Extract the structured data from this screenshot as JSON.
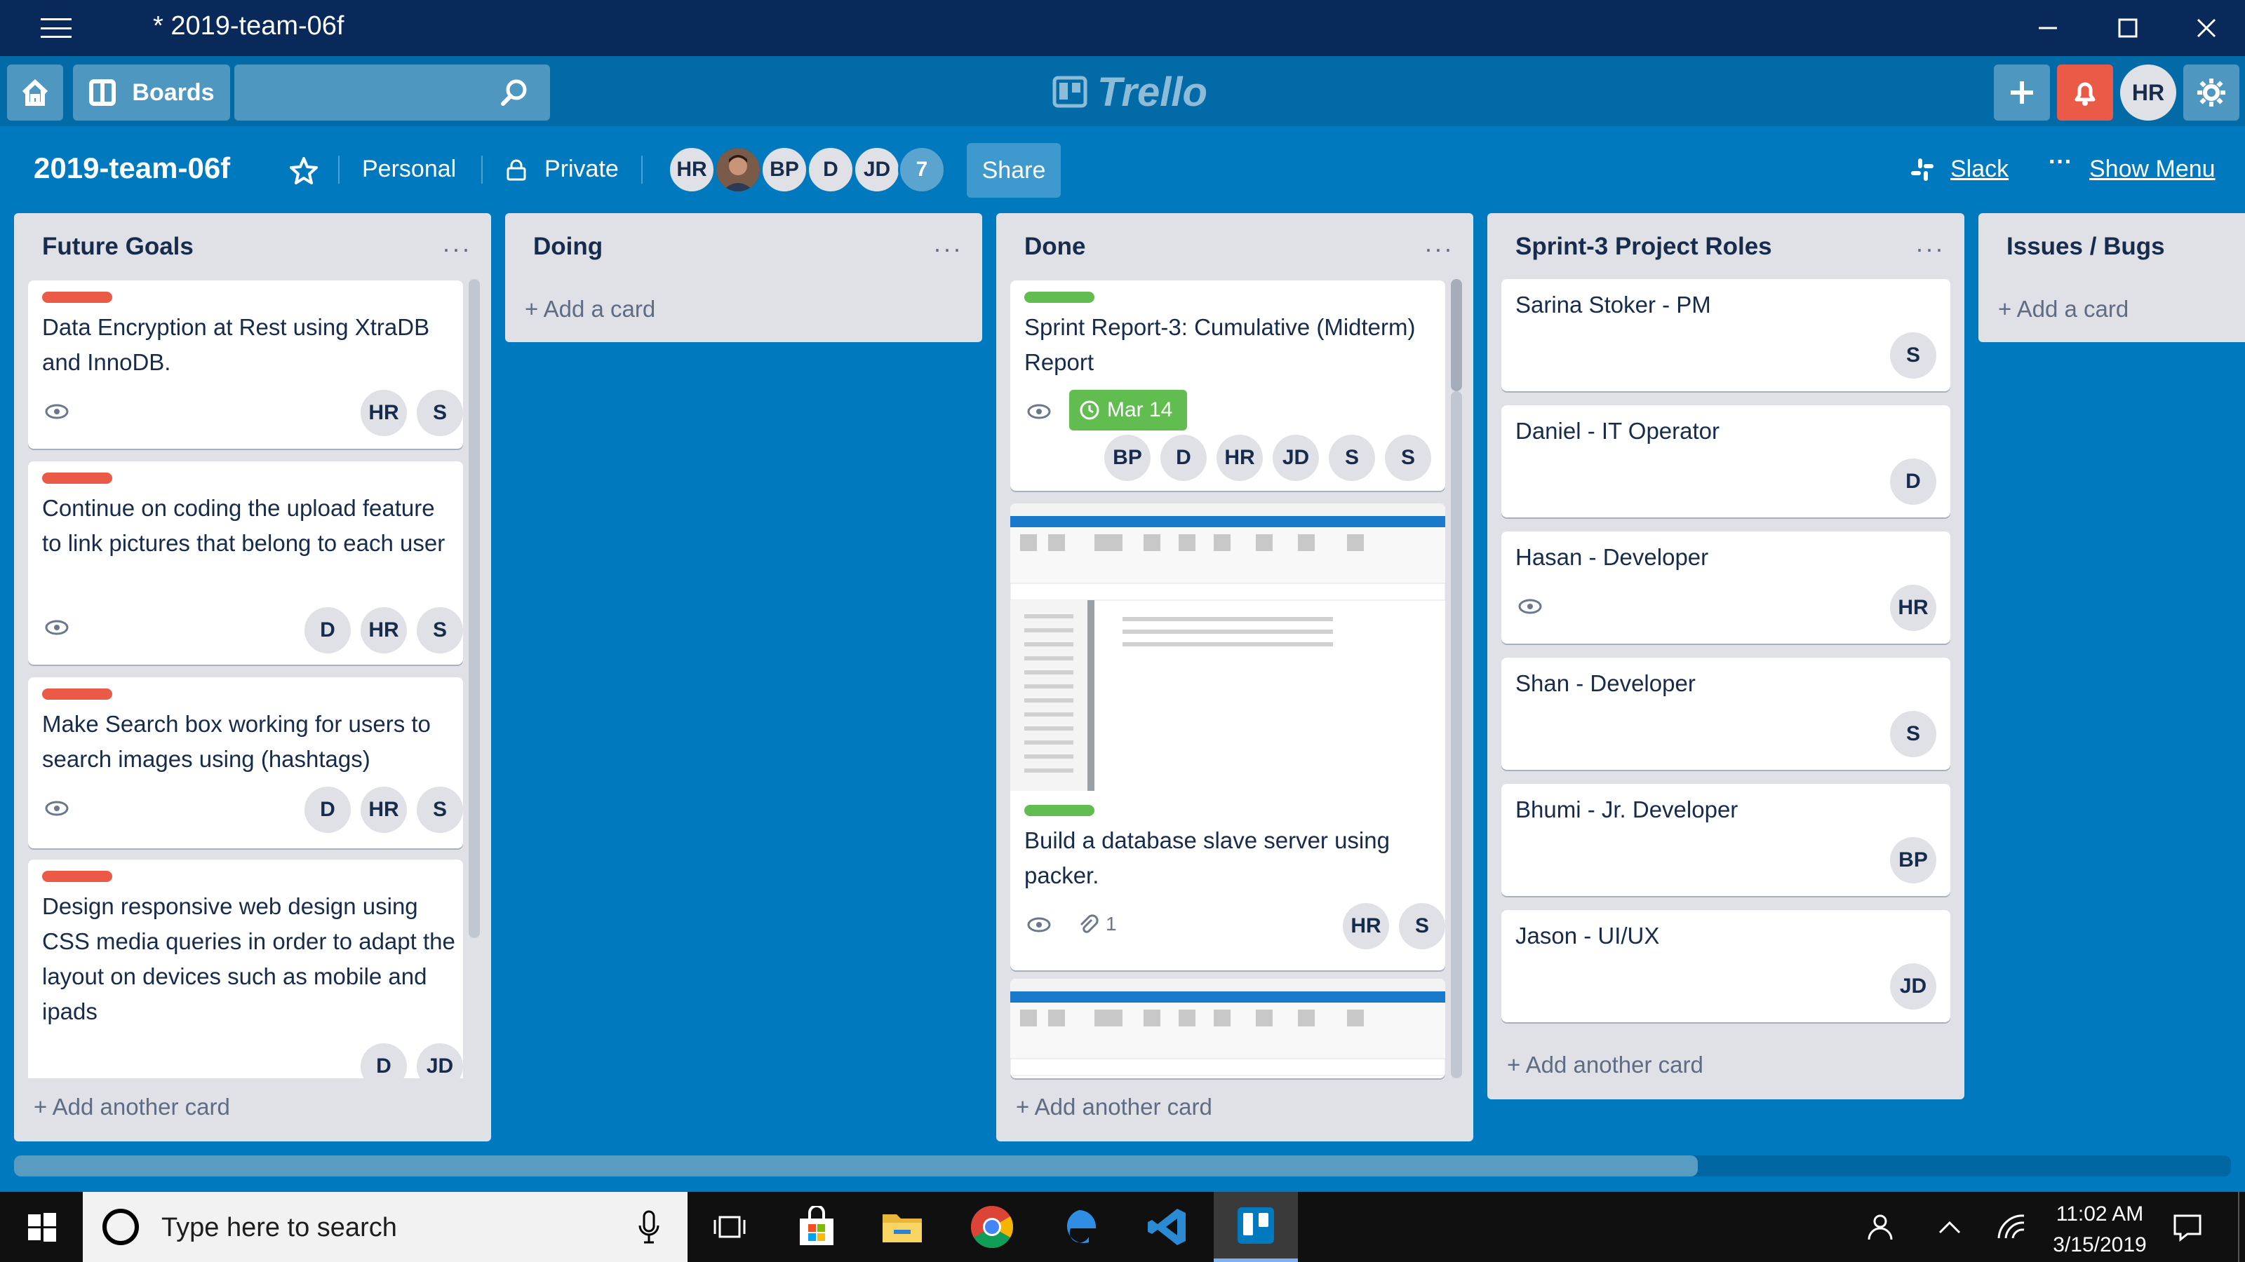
{
  "window": {
    "title": "* 2019-team-06f",
    "controls": [
      "minimize",
      "maximize",
      "close"
    ]
  },
  "header": {
    "boards_label": "Boards",
    "search_value": "",
    "logo_text": "Trello",
    "user_initials": "HR"
  },
  "board": {
    "name": "2019-team-06f",
    "team": "Personal",
    "visibility": "Private",
    "members": [
      "HR",
      "",
      "BP",
      "D",
      "JD"
    ],
    "member_overflow": "7",
    "share_label": "Share",
    "slack_label": "Slack",
    "show_menu_label": "Show Menu"
  },
  "lists": [
    {
      "title": "Future Goals",
      "add_label": "+ Add another card",
      "cards": [
        {
          "label": "red",
          "text": "Data Encryption at Rest using XtraDB and InnoDB.",
          "members": [
            "HR",
            "S"
          ]
        },
        {
          "label": "red",
          "text": "Continue on coding the upload feature to link pictures that belong to each user",
          "members": [
            "D",
            "HR",
            "S"
          ]
        },
        {
          "label": "red",
          "text": "Make Search box working for users to search images using (hashtags)",
          "members": [
            "D",
            "HR",
            "S"
          ]
        },
        {
          "label": "red",
          "text": "Design responsive web design using CSS media queries in order to adapt the layout on devices such as mobile and ipads",
          "members": [
            "D",
            "JD"
          ]
        }
      ]
    },
    {
      "title": "Doing",
      "add_label": "+ Add a card",
      "cards": []
    },
    {
      "title": "Done",
      "add_label": "+ Add another card",
      "cards": [
        {
          "label": "green",
          "text": "Sprint Report-3: Cumulative (Midterm) Report",
          "due": "Mar 14",
          "members": [
            "BP",
            "D",
            "HR",
            "JD",
            "S",
            "S"
          ]
        },
        {
          "label": "green",
          "text": "Build a database slave server using packer.",
          "attachments": "1",
          "members": [
            "HR",
            "S"
          ]
        }
      ]
    },
    {
      "title": "Sprint-3 Project Roles",
      "add_label": "+ Add another card",
      "cards": [
        {
          "text": "Sarina Stoker - PM",
          "members": [
            "S"
          ]
        },
        {
          "text": "Daniel - IT Operator",
          "members": [
            "D"
          ]
        },
        {
          "text": "Hasan - Developer",
          "members": [
            "HR"
          ]
        },
        {
          "text": "Shan - Developer",
          "members": [
            "S"
          ]
        },
        {
          "text": "Bhumi - Jr. Developer",
          "members": [
            "BP"
          ]
        },
        {
          "text": "Jason - UI/UX",
          "members": [
            "JD"
          ]
        }
      ]
    },
    {
      "title": "Issues / Bugs",
      "add_label": "+ Add a card",
      "cards": []
    }
  ],
  "taskbar": {
    "search_placeholder": "Type here to search",
    "time": "11:02 AM",
    "date": "3/15/2019"
  },
  "colors": {
    "board_bg": "#0079bf",
    "header_bg": "#026aa7",
    "titlebar_bg": "#09295a",
    "label_red": "#eb5a46",
    "label_green": "#61bd4f",
    "notif_red": "#eb5a46"
  }
}
